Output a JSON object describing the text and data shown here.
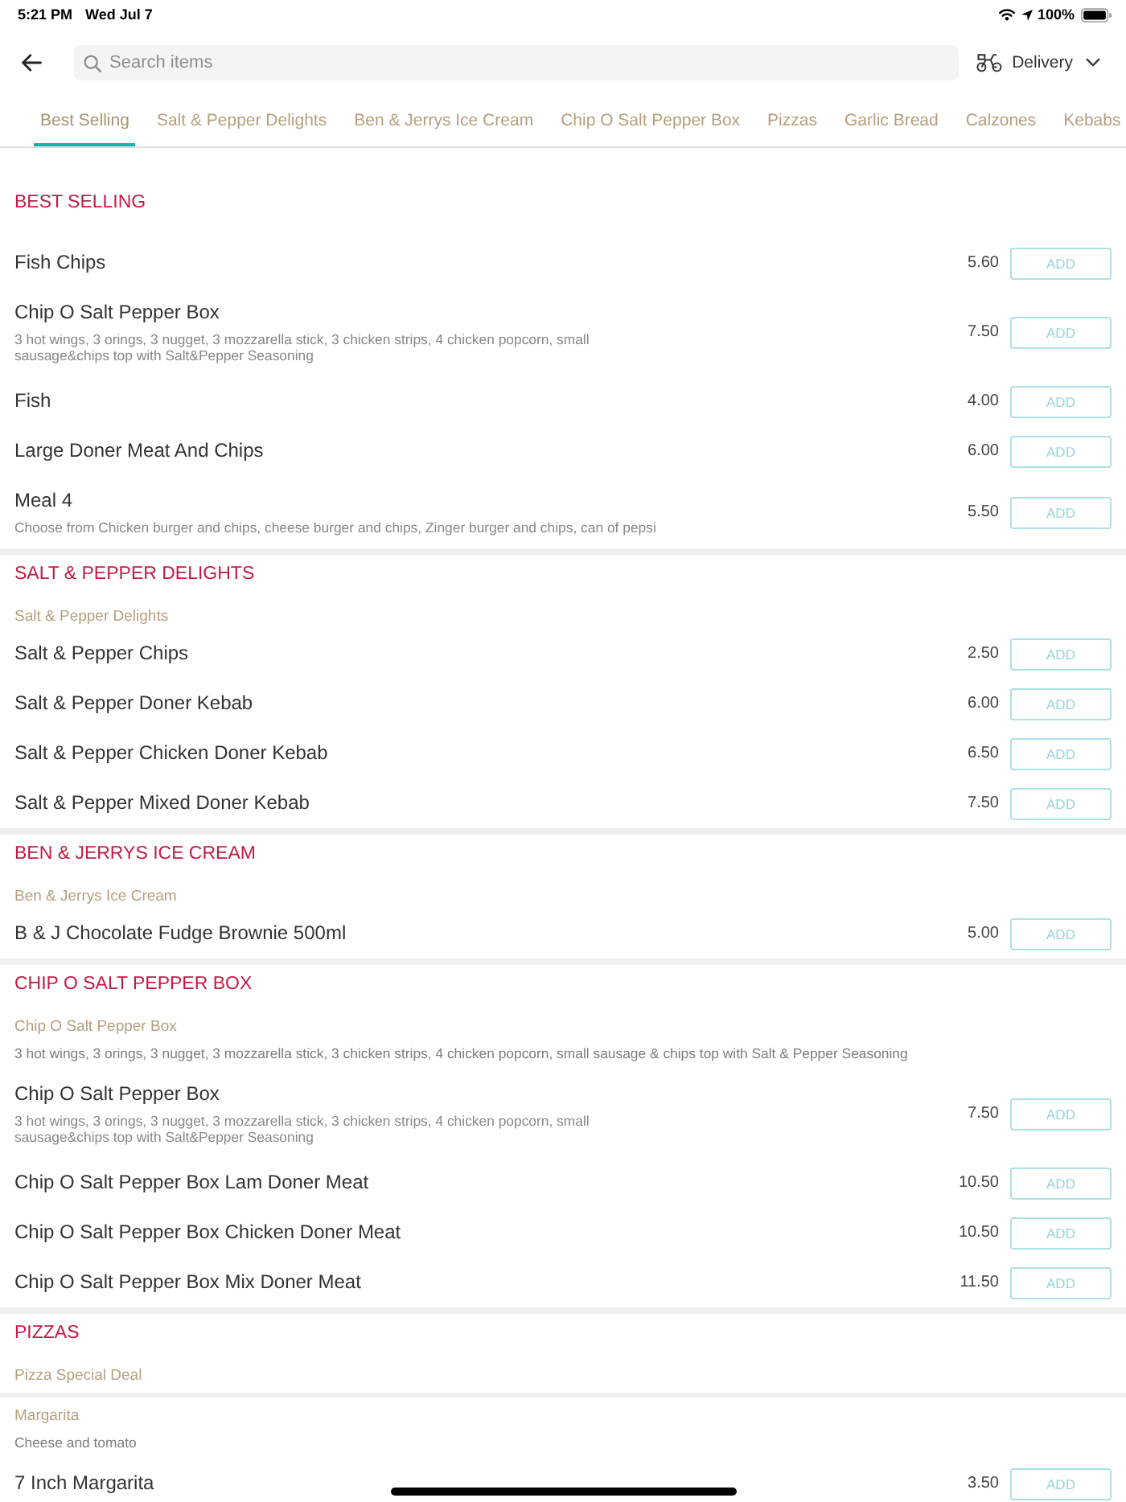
{
  "status_bar": {
    "time": "5:21 PM",
    "date": "Wed Jul 7",
    "battery": "100%"
  },
  "header": {
    "search": {
      "placeholder": "Search items"
    },
    "order_mode": {
      "label": "Delivery"
    }
  },
  "tabs": [
    {
      "label": "Best Selling",
      "selected": true
    },
    {
      "label": "Salt & Pepper Delights",
      "selected": false
    },
    {
      "label": "Ben & Jerrys Ice Cream",
      "selected": false
    },
    {
      "label": "Chip O Salt Pepper Box",
      "selected": false
    },
    {
      "label": "Pizzas",
      "selected": false
    },
    {
      "label": "Garlic Bread",
      "selected": false
    },
    {
      "label": "Calzones",
      "selected": false
    },
    {
      "label": "Kebabs",
      "selected": false
    }
  ],
  "sections": [
    {
      "title": "BEST SELLING",
      "groups": [
        {
          "items": [
            {
              "name": "Fish Chips",
              "price": "5.60",
              "button": "ADD"
            },
            {
              "name": "Chip O Salt Pepper Box",
              "description": "3 hot wings, 3 orings, 3 nugget, 3 mozzarella stick, 3 chicken strips, 4 chicken popcorn, small sausage&chips top with Salt&Pepper Seasoning",
              "price": "7.50",
              "button": "ADD"
            },
            {
              "name": "Fish",
              "price": "4.00",
              "button": "ADD"
            },
            {
              "name": "Large Doner Meat And Chips",
              "price": "6.00",
              "button": "ADD"
            },
            {
              "name": "Meal 4",
              "description": "Choose from Chicken burger and chips, cheese burger and chips, Zinger burger and chips, can of pepsi",
              "price": "5.50",
              "button": "ADD"
            }
          ]
        }
      ]
    },
    {
      "title": "SALT & PEPPER DELIGHTS",
      "groups": [
        {
          "title": "Salt & Pepper Delights",
          "items": [
            {
              "name": "Salt & Pepper Chips",
              "price": "2.50",
              "button": "ADD"
            },
            {
              "name": "Salt & Pepper Doner Kebab",
              "price": "6.00",
              "button": "ADD"
            },
            {
              "name": "Salt & Pepper Chicken Doner Kebab",
              "price": "6.50",
              "button": "ADD"
            },
            {
              "name": "Salt & Pepper Mixed Doner Kebab",
              "price": "7.50",
              "button": "ADD"
            }
          ]
        }
      ]
    },
    {
      "title": "BEN & JERRYS ICE CREAM",
      "groups": [
        {
          "title": "Ben & Jerrys Ice Cream",
          "items": [
            {
              "name": "B & J Chocolate Fudge Brownie 500ml",
              "price": "5.00",
              "button": "ADD"
            }
          ]
        }
      ]
    },
    {
      "title": "CHIP O SALT PEPPER BOX",
      "groups": [
        {
          "title": "Chip O Salt Pepper Box",
          "description": "3 hot wings, 3 orings, 3 nugget, 3 mozzarella stick, 3 chicken strips, 4 chicken popcorn, small sausage & chips top with Salt & Pepper Seasoning",
          "items": [
            {
              "name": "Chip O Salt Pepper Box",
              "description": "3 hot wings, 3 orings, 3 nugget, 3 mozzarella stick, 3 chicken strips, 4 chicken popcorn, small sausage&chips top with Salt&Pepper Seasoning",
              "price": "7.50",
              "button": "ADD"
            },
            {
              "name": "Chip O Salt Pepper Box Lam Doner Meat",
              "price": "10.50",
              "button": "ADD"
            },
            {
              "name": "Chip O Salt Pepper Box Chicken Doner Meat",
              "price": "10.50",
              "button": "ADD"
            },
            {
              "name": "Chip O Salt Pepper Box Mix Doner Meat",
              "price": "11.50",
              "button": "ADD"
            }
          ]
        }
      ]
    },
    {
      "title": "PIZZAS",
      "groups": [
        {
          "title": "Pizza Special Deal"
        },
        {
          "title": "Margarita",
          "description": "Cheese and tomato",
          "items": [
            {
              "name": "7 Inch Margarita",
              "price": "3.50",
              "button": "ADD"
            }
          ]
        }
      ]
    }
  ]
}
